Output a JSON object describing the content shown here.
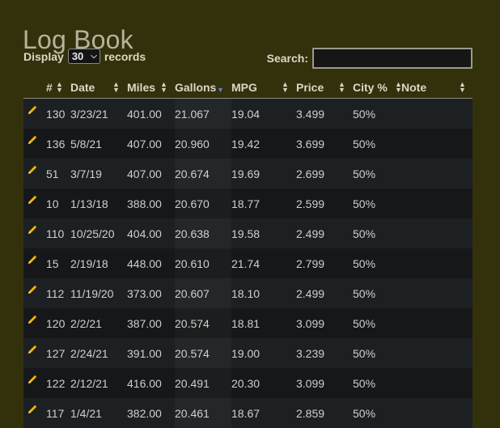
{
  "page": {
    "title": "Log Book",
    "display_label": "Display",
    "records_label": "records",
    "page_size": "30",
    "search_label": "Search:",
    "search_value": ""
  },
  "table": {
    "columns": [
      "#",
      "Date",
      "Miles",
      "Gallons",
      "MPG",
      "Price",
      "City %",
      "Note"
    ],
    "sorted_column": "Gallons",
    "sort_direction": "descending",
    "rows": [
      {
        "num": "130",
        "date": "3/23/21",
        "miles": "401.00",
        "gallons": "21.067",
        "mpg": "19.04",
        "price": "3.499",
        "city": "50%",
        "note": ""
      },
      {
        "num": "136",
        "date": "5/8/21",
        "miles": "407.00",
        "gallons": "20.960",
        "mpg": "19.42",
        "price": "3.699",
        "city": "50%",
        "note": ""
      },
      {
        "num": "51",
        "date": "3/7/19",
        "miles": "407.00",
        "gallons": "20.674",
        "mpg": "19.69",
        "price": "2.699",
        "city": "50%",
        "note": ""
      },
      {
        "num": "10",
        "date": "1/13/18",
        "miles": "388.00",
        "gallons": "20.670",
        "mpg": "18.77",
        "price": "2.599",
        "city": "50%",
        "note": ""
      },
      {
        "num": "110",
        "date": "10/25/20",
        "miles": "404.00",
        "gallons": "20.638",
        "mpg": "19.58",
        "price": "2.499",
        "city": "50%",
        "note": ""
      },
      {
        "num": "15",
        "date": "2/19/18",
        "miles": "448.00",
        "gallons": "20.610",
        "mpg": "21.74",
        "price": "2.799",
        "city": "50%",
        "note": ""
      },
      {
        "num": "112",
        "date": "11/19/20",
        "miles": "373.00",
        "gallons": "20.607",
        "mpg": "18.10",
        "price": "2.499",
        "city": "50%",
        "note": ""
      },
      {
        "num": "120",
        "date": "2/2/21",
        "miles": "387.00",
        "gallons": "20.574",
        "mpg": "18.81",
        "price": "3.099",
        "city": "50%",
        "note": ""
      },
      {
        "num": "127",
        "date": "2/24/21",
        "miles": "391.00",
        "gallons": "20.574",
        "mpg": "19.00",
        "price": "3.239",
        "city": "50%",
        "note": ""
      },
      {
        "num": "122",
        "date": "2/12/21",
        "miles": "416.00",
        "gallons": "20.491",
        "mpg": "20.30",
        "price": "3.099",
        "city": "50%",
        "note": ""
      },
      {
        "num": "117",
        "date": "1/4/21",
        "miles": "382.00",
        "gallons": "20.461",
        "mpg": "18.67",
        "price": "2.859",
        "city": "50%",
        "note": ""
      }
    ]
  },
  "icons": {
    "edit": "pencil-icon",
    "sort": "sort-arrows-icon",
    "select": "chevron-down-icon"
  },
  "colors": {
    "background": "#33300c",
    "row_odd": "#1d2022",
    "row_even": "#161718",
    "pencil": "#f2b705"
  }
}
